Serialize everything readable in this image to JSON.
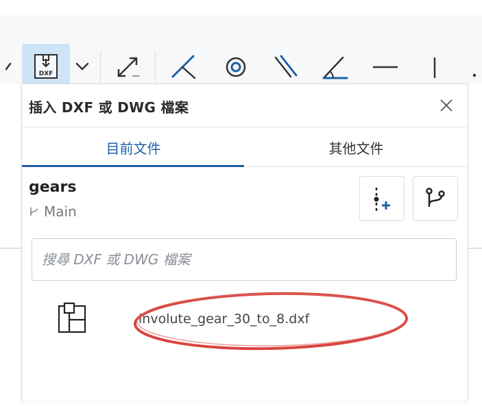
{
  "toolbar": {
    "icons": [
      "dropdown-caret-icon",
      "insert-dxf-icon",
      "chevron-down-icon",
      "transform-icon",
      "corner-icon",
      "circle-icon",
      "parallel-lines-icon",
      "angle-icon",
      "horizontal-line-icon",
      "vertical-line-icon"
    ],
    "dxf_icon_text": "DXF",
    "active_color": "#cfe4f6"
  },
  "panel": {
    "title": "插入 DXF 或 DWG 檔案",
    "tabs": [
      {
        "label": "目前文件",
        "active": true
      },
      {
        "label": "其他文件",
        "active": false
      }
    ],
    "document": {
      "name": "gears",
      "branch": "Main"
    },
    "search": {
      "placeholder": "搜尋 DXF 或 DWG 檔案",
      "value": ""
    },
    "files": [
      {
        "name": "involute_gear_30_to_8.dxf",
        "icon": "sketch-file-icon",
        "highlighted": true
      }
    ]
  },
  "colors": {
    "accent": "#1e5fa8",
    "annotation": "#d9453f"
  }
}
